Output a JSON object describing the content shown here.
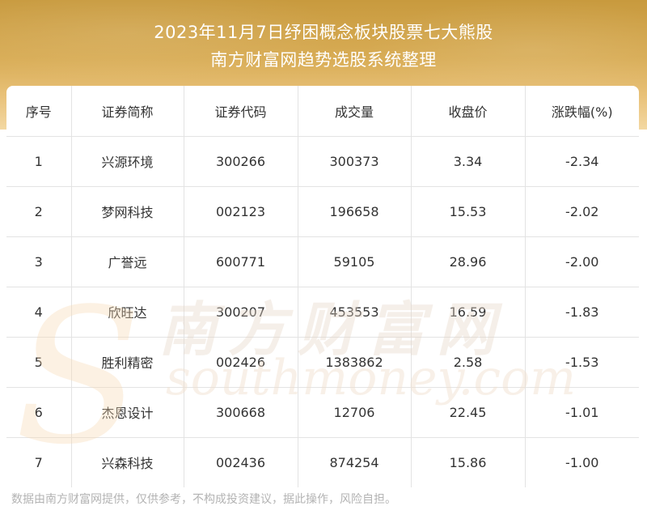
{
  "header": {
    "title_line1": "2023年11月7日纾困概念板块股票七大熊股",
    "title_line2": "南方财富网趋势选股系统整理"
  },
  "table": {
    "columns": [
      "序号",
      "证券简称",
      "证券代码",
      "成交量",
      "收盘价",
      "涨跌幅(%)"
    ],
    "rows": [
      [
        "1",
        "兴源环境",
        "300266",
        "300373",
        "3.34",
        "-2.34"
      ],
      [
        "2",
        "梦网科技",
        "002123",
        "196658",
        "15.53",
        "-2.02"
      ],
      [
        "3",
        "广誉远",
        "600771",
        "59105",
        "28.96",
        "-2.00"
      ],
      [
        "4",
        "欣旺达",
        "300207",
        "453553",
        "16.59",
        "-1.83"
      ],
      [
        "5",
        "胜利精密",
        "002426",
        "1383862",
        "2.58",
        "-1.53"
      ],
      [
        "6",
        "杰恩设计",
        "300668",
        "12706",
        "22.45",
        "-1.01"
      ],
      [
        "7",
        "兴森科技",
        "002436",
        "874254",
        "15.86",
        "-1.00"
      ]
    ]
  },
  "watermark": {
    "brand_cn": "南方财富网",
    "brand_en": "southmoney.com"
  },
  "footer": {
    "note": "数据由南方财富网提供，仅供参考，不构成投资建议，据此操作，风险自担。"
  }
}
